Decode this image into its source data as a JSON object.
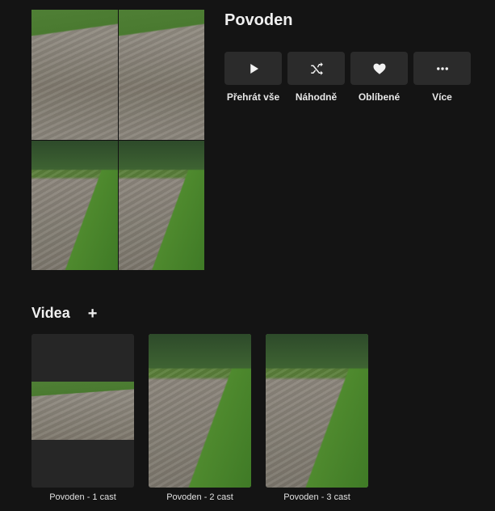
{
  "album": {
    "title": "Povoden",
    "collage_tiles": [
      "scene-a",
      "scene-a",
      "scene-b",
      "scene-b"
    ]
  },
  "actions": [
    {
      "label": "Přehrát vše",
      "icon": "play-icon"
    },
    {
      "label": "Náhodně",
      "icon": "shuffle-icon"
    },
    {
      "label": "Oblíbené",
      "icon": "heart-icon"
    },
    {
      "label": "Více",
      "icon": "more-icon"
    }
  ],
  "videos_section": {
    "title": "Videa",
    "add_label": "+"
  },
  "videos": [
    {
      "label": "Povoden - 1 cast",
      "thumb": "landscape"
    },
    {
      "label": "Povoden - 2 cast",
      "thumb": "portrait"
    },
    {
      "label": "Povoden - 3 cast",
      "thumb": "portrait"
    }
  ],
  "colors": {
    "background": "#141414",
    "button_bg": "#2b2b2b",
    "text": "#e8e8e8"
  }
}
